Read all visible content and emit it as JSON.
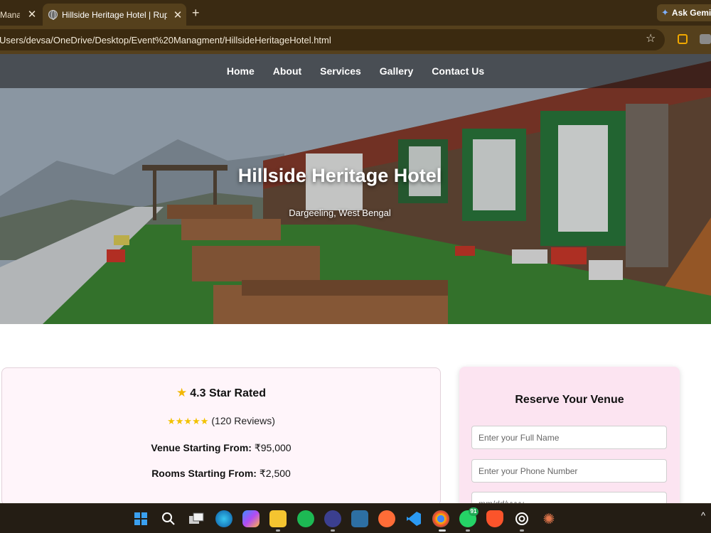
{
  "browser": {
    "tabs": [
      {
        "title": "Managem",
        "active": false
      },
      {
        "title": "Hillside Heritage Hotel | Rupkot",
        "active": true
      }
    ],
    "close_glyph": "✕",
    "new_tab_glyph": "+",
    "ask_gemini": "Ask Gemini",
    "url": "Users/devsa/OneDrive/Desktop/Event%20Managment/HillsideHeritageHotel.html"
  },
  "nav": {
    "links": [
      "Home",
      "About",
      "Services",
      "Gallery",
      "Contact Us"
    ]
  },
  "hero": {
    "title": "Hillside Heritage Hotel",
    "subtitle": "Dargeeling, West Bengal"
  },
  "rating": {
    "headline": "4.3 Star Rated",
    "stars": "★★★★★",
    "reviews": "(120 Reviews)",
    "venue_label": "Venue Starting From:",
    "venue_price": "₹95,000",
    "rooms_label": "Rooms Starting From:",
    "rooms_price": "₹2,500"
  },
  "reserve": {
    "title": "Reserve Your Venue",
    "name_placeholder": "Enter your Full Name",
    "phone_placeholder": "Enter your Phone Number",
    "date_placeholder": "mm/dd/yyyy"
  },
  "taskbar": {
    "whatsapp_badge": "91"
  },
  "icons": [
    "globe-icon",
    "star-bookmark-icon",
    "gemini-icon",
    "windows-start-icon",
    "search-icon",
    "task-view-icon",
    "edge-icon",
    "copilot-icon",
    "file-explorer-icon",
    "spotify-icon",
    "app-icon",
    "app-icon",
    "postman-icon",
    "vscode-icon",
    "chrome-icon",
    "whatsapp-icon",
    "brave-icon",
    "chatgpt-icon",
    "claude-icon",
    "chevron-up-icon"
  ]
}
